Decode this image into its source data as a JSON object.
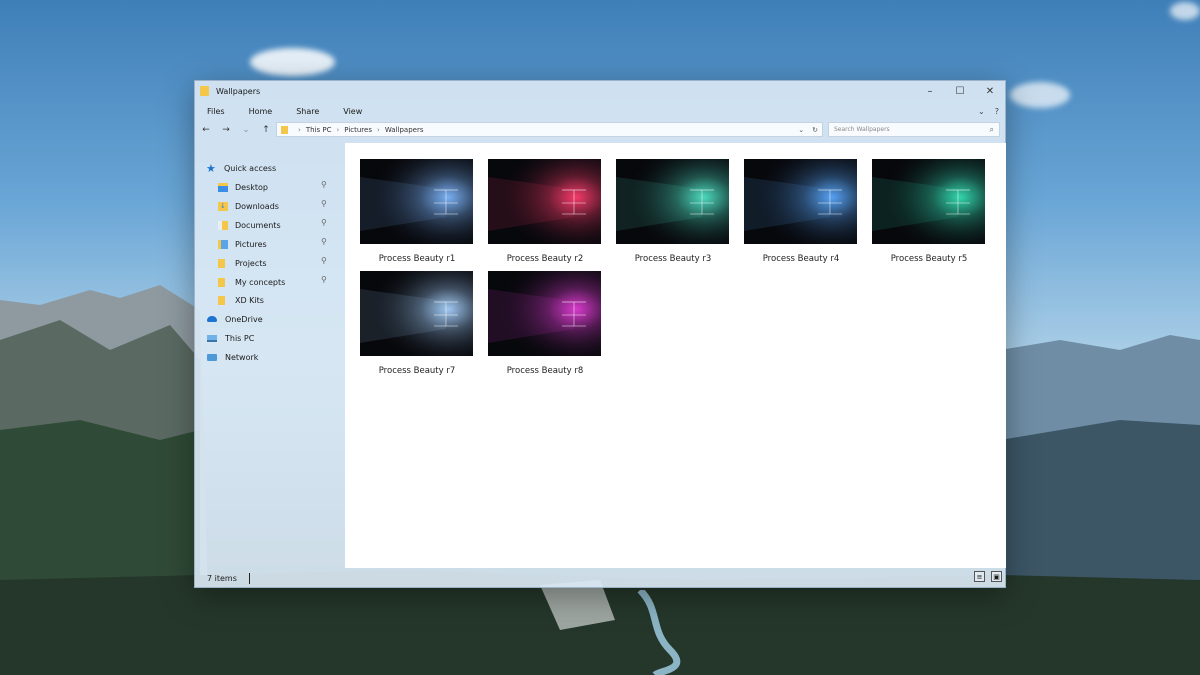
{
  "window": {
    "title": "Wallpapers",
    "controls": {
      "minimize": "–",
      "maximize": "☐",
      "close": "✕"
    }
  },
  "ribbon": {
    "tabs": [
      "Files",
      "Home",
      "Share",
      "View"
    ],
    "expand_icon": "chevron-down-icon",
    "help_label": "?"
  },
  "navigation": {
    "back": "←",
    "forward": "→",
    "recent": "⌄",
    "up": "↑",
    "breadcrumb": [
      "This PC",
      "Pictures",
      "Wallpapers"
    ],
    "separator": "›",
    "dropdown": "⌄",
    "refresh": "↻",
    "search_placeholder": "Search Wallpapers",
    "search_icon": "⌕"
  },
  "sidebar": {
    "quick_access": "Quick access",
    "pinned": [
      {
        "label": "Desktop",
        "icon": "desktop-folder-icon",
        "color": "#3a8ee6"
      },
      {
        "label": "Downloads",
        "icon": "downloads-folder-icon",
        "color": "#2a7fd8"
      },
      {
        "label": "Documents",
        "icon": "documents-folder-icon",
        "color": "#e9edf2"
      },
      {
        "label": "Pictures",
        "icon": "pictures-folder-icon",
        "color": "#5aa4e8"
      },
      {
        "label": "Projects",
        "icon": "folder-icon",
        "color": "#f4c64a"
      },
      {
        "label": "My concepts",
        "icon": "folder-icon",
        "color": "#f4c64a"
      }
    ],
    "other_folder": "XD Kits",
    "onedrive": "OneDrive",
    "this_pc": "This PC",
    "network": "Network",
    "pin_glyph": "⚲"
  },
  "files": [
    {
      "name": "Process Beauty r1",
      "accent": "#7fb8ff"
    },
    {
      "name": "Process Beauty r2",
      "accent": "#ff3d6e"
    },
    {
      "name": "Process Beauty r3",
      "accent": "#4fe3c6"
    },
    {
      "name": "Process Beauty r4",
      "accent": "#5aa9ff"
    },
    {
      "name": "Process Beauty r5",
      "accent": "#35e0b5"
    },
    {
      "name": "Process Beauty r7",
      "accent": "#a8d2ff"
    },
    {
      "name": "Process Beauty r8",
      "accent": "#e23dd6"
    }
  ],
  "status": {
    "item_count": "7 items",
    "details_view_icon": "details-view-icon",
    "large_icons_view_icon": "large-icons-view-icon"
  }
}
